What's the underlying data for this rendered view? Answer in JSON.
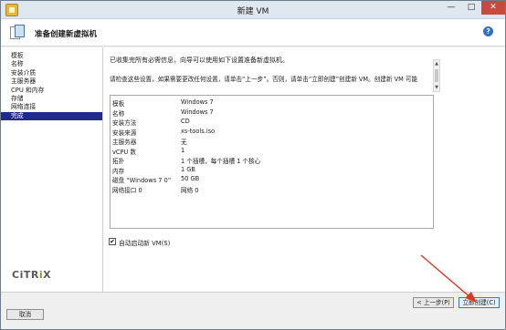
{
  "window": {
    "title": "新建 VM",
    "minimize": "—",
    "maximize": "□",
    "close": "✕"
  },
  "header": {
    "title": "准备创建新虚拟机",
    "help": "?"
  },
  "nav": {
    "items": [
      {
        "label": "模板",
        "active": false
      },
      {
        "label": "名称",
        "active": false
      },
      {
        "label": "安装介质",
        "active": false
      },
      {
        "label": "主服务器",
        "active": false
      },
      {
        "label": "CPU 和内存",
        "active": false
      },
      {
        "label": "存储",
        "active": false
      },
      {
        "label": "网络连接",
        "active": false
      },
      {
        "label": "完成",
        "active": true
      }
    ],
    "logo": {
      "before": "CiTR",
      "dot": "i",
      "after": "X"
    }
  },
  "content": {
    "intro": "已收集完所有必需信息，向导可以使用如下设置准备新虚拟机。",
    "instructions": "请检查这些设置，如果需要更改任何设置，请单击“上一步”。否则，请单击“立即创建”创建新 VM。创建新 VM 可能",
    "summary": [
      {
        "label": "模板",
        "value": "Windows 7"
      },
      {
        "label": "名称",
        "value": "Windows 7"
      },
      {
        "label": "安装方法",
        "value": "CD"
      },
      {
        "label": "安装来源",
        "value": "xs-tools.iso"
      },
      {
        "label": "主服务器",
        "value": "无"
      },
      {
        "label": "vCPU 数",
        "value": "1"
      },
      {
        "label": "拓扑",
        "value": "1 个插槽，每个插槽 1 个核心"
      },
      {
        "label": "内存",
        "value": "1 GB"
      },
      {
        "label": "磁盘 “Windows 7 0”",
        "value": "50 GB"
      },
      {
        "label": "网络接口 0",
        "value": "网络 0"
      }
    ],
    "autostart": {
      "label": "自动启动新 VM(S)",
      "checked": true,
      "check_glyph": "✔"
    }
  },
  "footer": {
    "prev_label": "< 上一步(P)",
    "create_label": "立即创建(C)",
    "cancel_label": "取消"
  },
  "colors": {
    "nav_active": "#1e2a8c",
    "annotation_arrow": "#e0372b",
    "close_button": "#c74a3c"
  }
}
